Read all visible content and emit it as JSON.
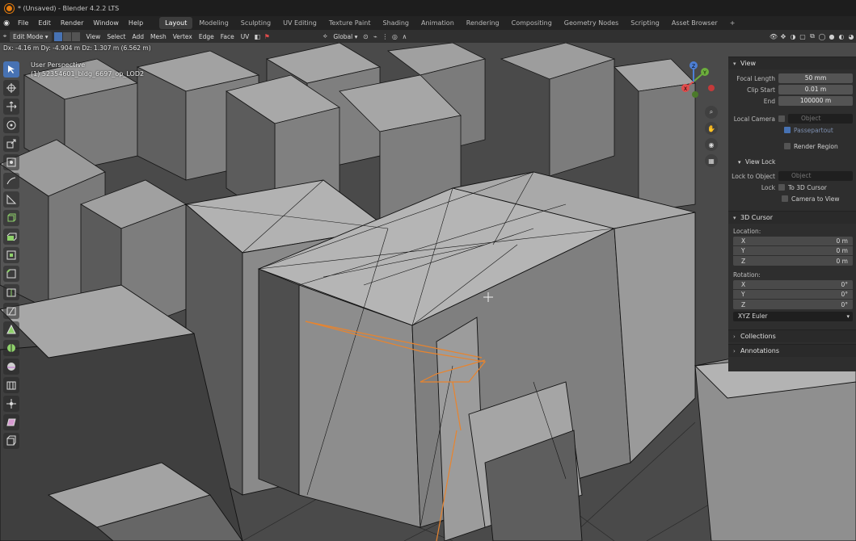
{
  "window": {
    "title": "* (Unsaved) - Blender 4.2.2 LTS"
  },
  "menu": {
    "items": [
      "File",
      "Edit",
      "Render",
      "Window",
      "Help"
    ]
  },
  "workspaces": {
    "active_index": 0,
    "tabs": [
      "Layout",
      "Modeling",
      "Sculpting",
      "UV Editing",
      "Texture Paint",
      "Shading",
      "Animation",
      "Rendering",
      "Compositing",
      "Geometry Nodes",
      "Scripting",
      "Asset Browser"
    ],
    "add_label": "+"
  },
  "header": {
    "mode": "Edit Mode",
    "menus": [
      "View",
      "Select",
      "Add",
      "Mesh",
      "Vertex",
      "Edge",
      "Face",
      "UV"
    ],
    "transform_orientation": "Global"
  },
  "viewport": {
    "status": "Dx: -4.16 m   Dy: -4.904 m   Dz: 1.307 m (6.562 m)",
    "view_name": "User Perspective",
    "object_name": "(1) 52354601_bldg_6697_op_LOD2"
  },
  "gizmo": {
    "x": "X",
    "y": "Y",
    "z": "Z"
  },
  "sidebar": {
    "view": {
      "header": "View",
      "focal_length_label": "Focal Length",
      "focal_length": "50 mm",
      "clip_start_label": "Clip Start",
      "clip_start": "0.01 m",
      "end_label": "End",
      "end": "100000 m",
      "local_camera_label": "Local Camera",
      "local_camera_placeholder": "Object",
      "passepartout_label": "Passepartout",
      "render_region_label": "Render Region"
    },
    "view_lock": {
      "header": "View Lock",
      "lock_to_object_label": "Lock to Object",
      "lock_to_object_placeholder": "Object",
      "lock_label": "Lock",
      "to_3d_cursor_label": "To 3D Cursor",
      "camera_to_view_label": "Camera to View"
    },
    "cursor": {
      "header": "3D Cursor",
      "location_label": "Location:",
      "location": [
        {
          "axis": "X",
          "value": "0 m"
        },
        {
          "axis": "Y",
          "value": "0 m"
        },
        {
          "axis": "Z",
          "value": "0 m"
        }
      ],
      "rotation_label": "Rotation:",
      "rotation": [
        {
          "axis": "X",
          "value": "0°"
        },
        {
          "axis": "Y",
          "value": "0°"
        },
        {
          "axis": "Z",
          "value": "0°"
        }
      ],
      "rotation_mode": "XYZ Euler"
    },
    "collections_header": "Collections",
    "annotations_header": "Annotations"
  },
  "colors": {
    "accent": "#4772b3",
    "selection_edge": "#e8842e",
    "wire": "#1a1a1a"
  },
  "tools": [
    "select-box-icon",
    "cursor-icon",
    "move-icon",
    "rotate-icon",
    "scale-icon",
    "transform-icon",
    "annotate-icon",
    "measure-icon",
    "add-cube-icon",
    "extrude-icon",
    "inset-icon",
    "bevel-icon",
    "loop-cut-icon",
    "knife-icon",
    "poly-build-icon",
    "spin-icon",
    "smooth-icon",
    "edge-slide-icon",
    "shrink-fatten-icon",
    "shear-icon",
    "rip-icon"
  ]
}
